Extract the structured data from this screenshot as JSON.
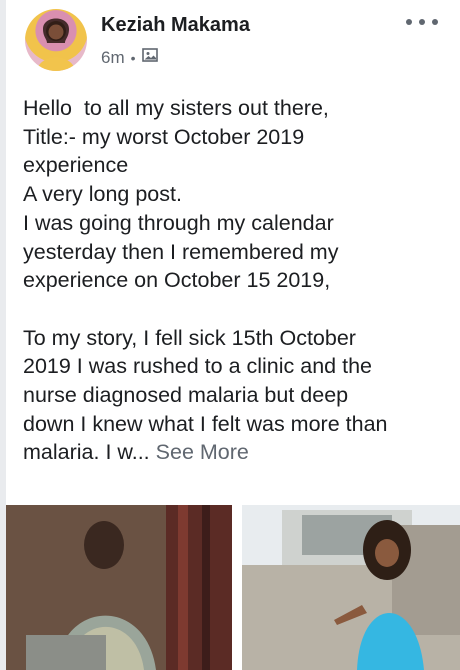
{
  "post": {
    "author": "Keziah Makama",
    "time": "6m",
    "separator": "•",
    "audience_icon": "photo-icon",
    "menu_icon": "more-dots-icon",
    "lines": [
      "Hello  to all my sisters out there,",
      "Title:- my worst October 2019",
      "experience",
      "A very long post.",
      "I was going through my calendar",
      "yesterday then I remembered my",
      "experience on October 15 2019,"
    ],
    "lines2": [
      "To my story, I fell sick 15th October",
      "2019 I was rushed to a clinic and the",
      "nurse diagnosed malaria but deep",
      "down I knew what I felt was more than"
    ],
    "truncated_line": "malaria. I w...",
    "see_more": "See More"
  },
  "colors": {
    "text": "#1c1e21",
    "muted": "#606770",
    "background": "#e9ebee"
  }
}
